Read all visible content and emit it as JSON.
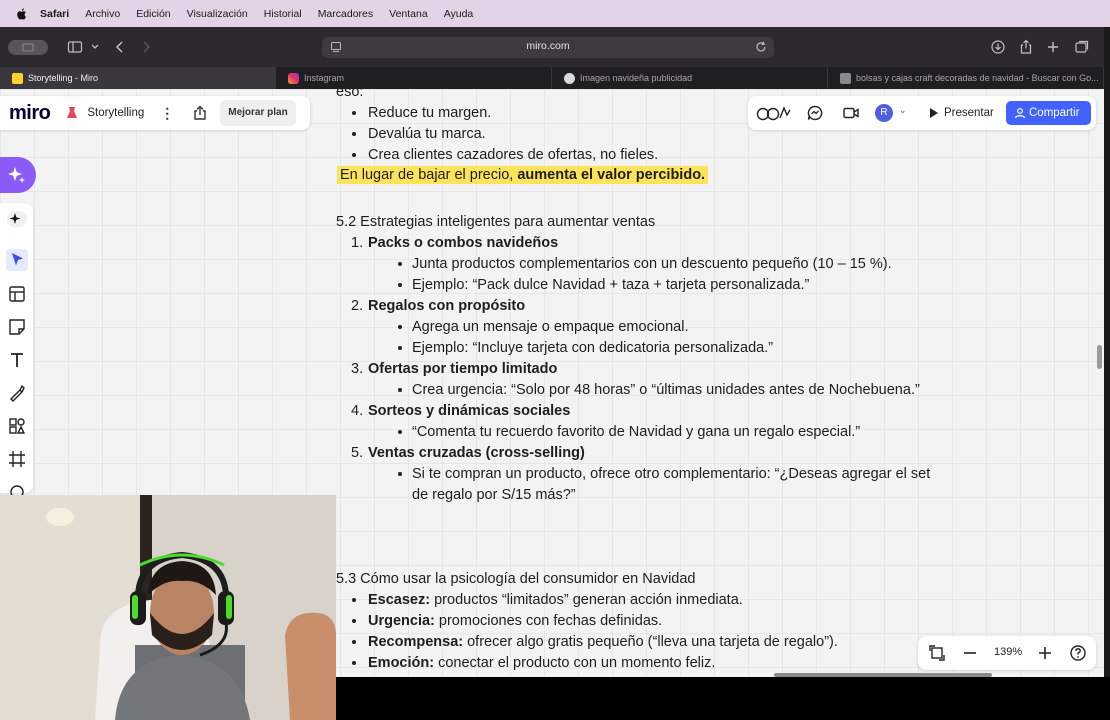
{
  "menubar": {
    "app": "Safari",
    "items": [
      "Archivo",
      "Edición",
      "Visualización",
      "Historial",
      "Marcadores",
      "Ventana",
      "Ayuda"
    ]
  },
  "browser": {
    "url": "miro.com",
    "tabs": [
      {
        "title": "Storytelling - Miro",
        "active": true,
        "icon": "miro-favicon"
      },
      {
        "title": "Instagram",
        "active": false,
        "icon": "instagram-favicon"
      },
      {
        "title": "Imagen navideña publicidad",
        "active": false,
        "icon": "ai-favicon"
      },
      {
        "title": "bolsas y cajas craft decoradas de navidad - Buscar con Go...",
        "active": false,
        "icon": "google-favicon"
      }
    ]
  },
  "miro": {
    "logo": "miro",
    "board_title": "Storytelling",
    "upgrade_label": "Mejorar plan",
    "present_label": "Presentar",
    "share_label": "Compartir",
    "avatar_initial": "R",
    "zoom": "139%",
    "accent": "#4262ff"
  },
  "doc": {
    "intro_tail": "eso:",
    "intro_bullets": [
      "Reduce tu margen.",
      "Devalúa tu marca.",
      "Crea clientes cazadores de ofertas, no fieles."
    ],
    "highlight_normal": "En lugar de bajar el precio, ",
    "highlight_bold": "aumenta el valor percibido.",
    "s52_title": "5.2 Estrategias inteligentes para aumentar ventas",
    "s52_items": [
      {
        "num": "1.",
        "title": "Packs o combos navideños",
        "subs": [
          "Junta productos complementarios con un descuento pequeño (10 – 15 %).",
          "Ejemplo: “Pack dulce Navidad + taza + tarjeta personalizada.”"
        ]
      },
      {
        "num": "2.",
        "title": "Regalos con propósito",
        "subs": [
          "Agrega un mensaje o empaque emocional.",
          "Ejemplo: “Incluye tarjeta con dedicatoria personalizada.”"
        ]
      },
      {
        "num": "3.",
        "title": "Ofertas por tiempo limitado",
        "subs": [
          "Crea urgencia: “Solo por 48 horas” o “últimas unidades antes de Nochebuena.”"
        ]
      },
      {
        "num": "4.",
        "title": "Sorteos y dinámicas sociales",
        "subs": [
          "“Comenta tu recuerdo favorito de Navidad y gana un regalo especial.”"
        ]
      },
      {
        "num": "5.",
        "title": "Ventas cruzadas (cross-selling)",
        "subs": [
          "Si te compran un producto, ofrece otro complementario: “¿Deseas agregar el set",
          "de regalo por S/15 más?”"
        ]
      }
    ],
    "s53_title": "5.3 Cómo usar la psicología del consumidor en Navidad",
    "s53_items": [
      {
        "bold": "Escasez:",
        "text": " productos “limitados” generan acción inmediata."
      },
      {
        "bold": "Urgencia:",
        "text": " promociones con fechas definidas."
      },
      {
        "bold": "Recompensa:",
        "text": " ofrecer algo gratis pequeño (“lleva una tarjeta de regalo”)."
      },
      {
        "bold": "Emoción:",
        "text": " conectar el producto con un momento feliz."
      }
    ]
  }
}
